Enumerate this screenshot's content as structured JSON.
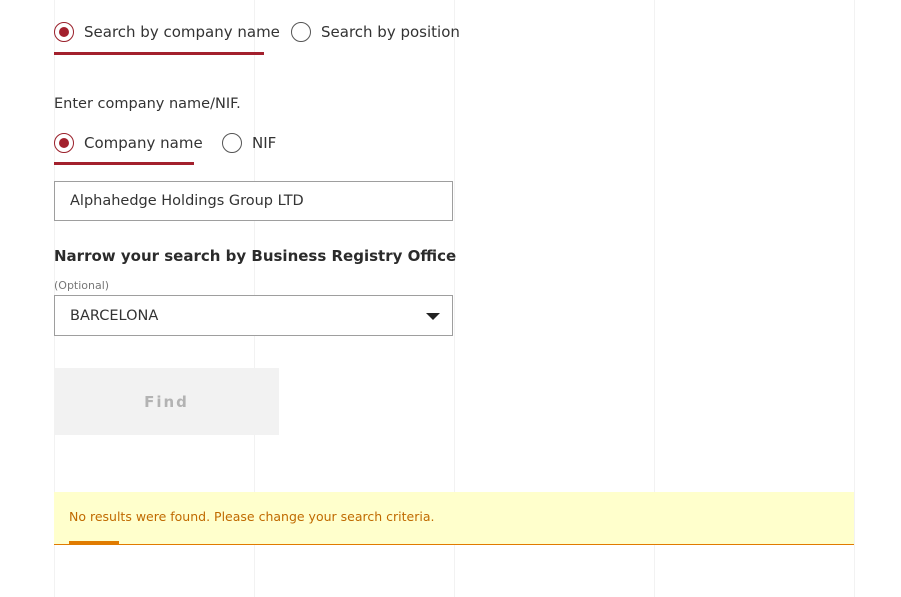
{
  "search_mode": {
    "options": [
      {
        "label": "Search by company name",
        "checked": true
      },
      {
        "label": "Search by position",
        "checked": false
      }
    ]
  },
  "company_search": {
    "prompt": "Enter company name/NIF.",
    "options": [
      {
        "label": "Company name",
        "checked": true
      },
      {
        "label": "NIF",
        "checked": false
      }
    ],
    "input_value": "Alphahedge Holdings Group LTD"
  },
  "registry_filter": {
    "heading": "Narrow your search by Business Registry Office",
    "hint": "(Optional)",
    "selected": "BARCELONA",
    "icon": "chevron-down-icon"
  },
  "find_button": {
    "label": "Find",
    "enabled": false
  },
  "alert": {
    "message": "No results were found. Please change your search criteria.",
    "background": "#ffffcc",
    "accent_color": "#e07b00"
  },
  "colors": {
    "accent": "#a3202d"
  }
}
